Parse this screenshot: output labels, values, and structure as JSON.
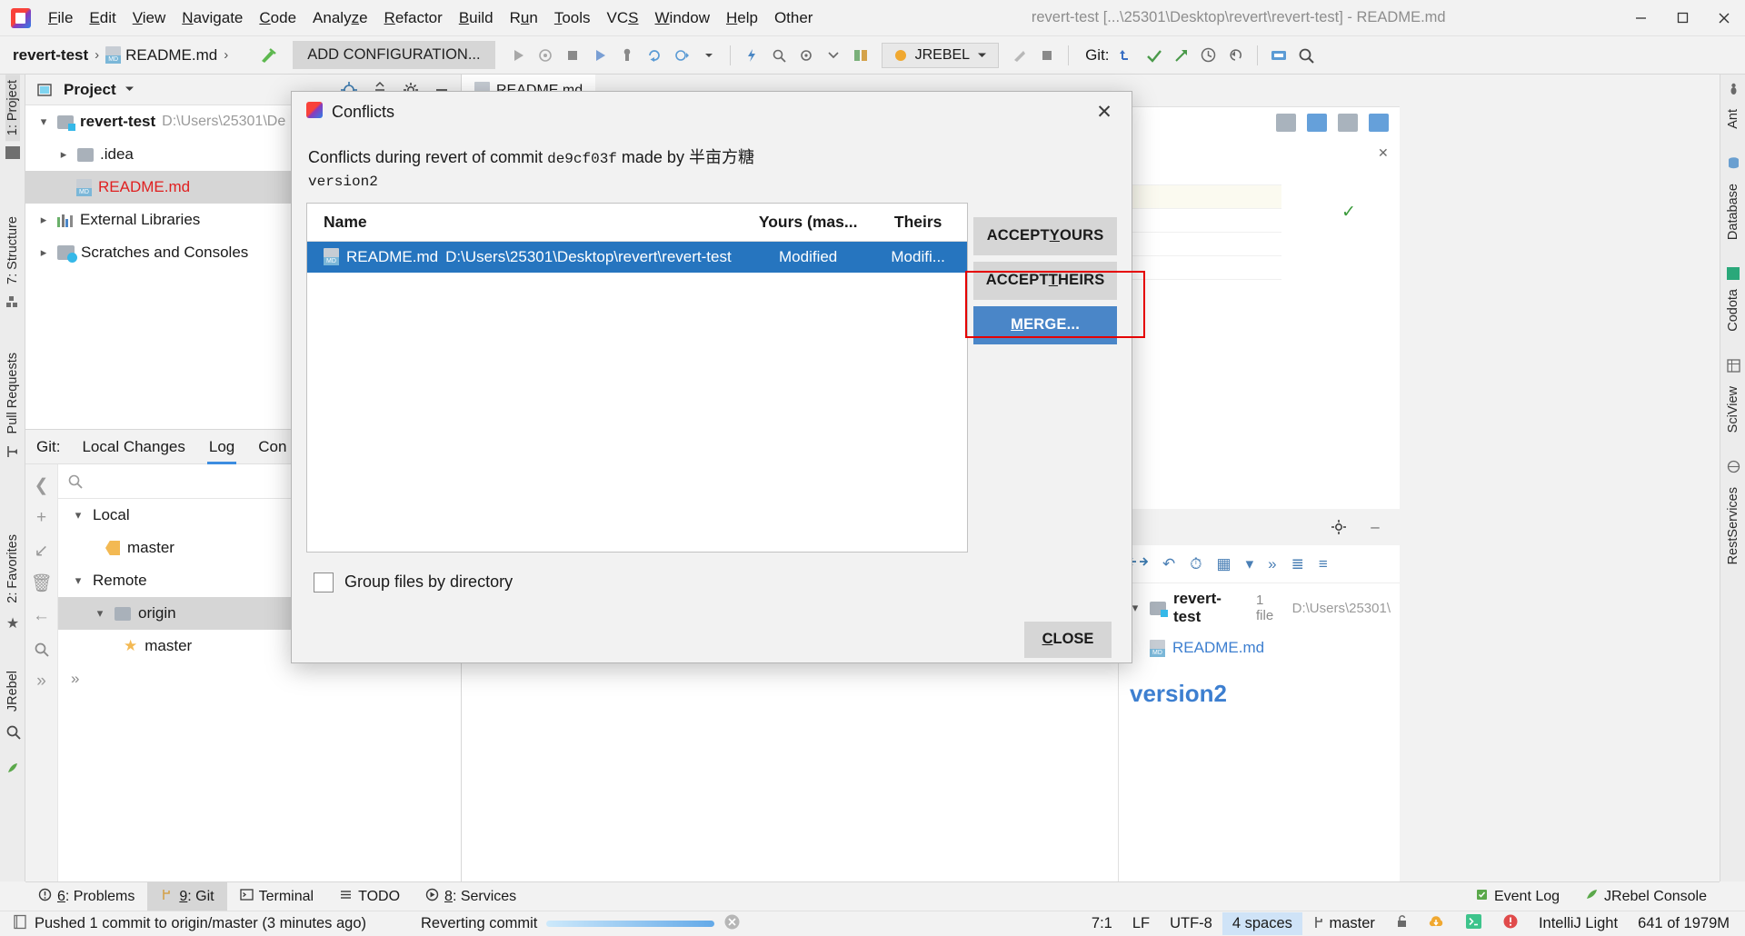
{
  "titlebar": {
    "menus": [
      "File",
      "Edit",
      "View",
      "Navigate",
      "Code",
      "Analyze",
      "Refactor",
      "Build",
      "Run",
      "Tools",
      "VCS",
      "Window",
      "Help",
      "Other"
    ],
    "window_title": "revert-test [...\\25301\\Desktop\\revert\\revert-test] - README.md",
    "minimize": "–",
    "maximize": "❐",
    "close": "✕"
  },
  "navbar": {
    "breadcrumb_project": "revert-test",
    "breadcrumb_file": "README.md",
    "separator": "›",
    "add_configuration": "ADD CONFIGURATION...",
    "jrebel_label": "JREBEL",
    "git_label": "Git:"
  },
  "left_stripe": {
    "project": "1: Project",
    "structure": "7: Structure",
    "pull_requests": "Pull Requests",
    "favorites": "2: Favorites",
    "jrebel": "JRebel"
  },
  "right_stripe": {
    "ant": "Ant",
    "database": "Database",
    "codota": "Codota",
    "sciview": "SciView",
    "restservices": "RestServices"
  },
  "project_panel": {
    "title": "Project",
    "tree": [
      {
        "label": "revert-test",
        "path": "D:\\Users\\25301\\De",
        "icon": "folder-module-icon",
        "expanded": true,
        "indent": 0,
        "bold": true
      },
      {
        "label": ".idea",
        "path": "",
        "icon": "folder-icon",
        "expanded": false,
        "indent": 1,
        "bold": false
      },
      {
        "label": "README.md",
        "path": "",
        "icon": "markdown-icon",
        "expanded": null,
        "indent": 2,
        "bold": false,
        "selected": true,
        "color": "#e02020"
      },
      {
        "label": "External Libraries",
        "path": "",
        "icon": "libraries-icon",
        "expanded": false,
        "indent": 0,
        "bold": false
      },
      {
        "label": "Scratches and Consoles",
        "path": "",
        "icon": "scratches-icon",
        "expanded": false,
        "indent": 0,
        "bold": false
      }
    ]
  },
  "git_panel": {
    "label": "Git:",
    "tabs": [
      {
        "label": "Local Changes",
        "active": false
      },
      {
        "label": "Log",
        "active": true
      },
      {
        "label": "Con",
        "active": false
      }
    ],
    "search_placeholder": "",
    "branches": [
      {
        "label": "Local",
        "type": "group",
        "expanded": true
      },
      {
        "label": "master",
        "type": "tag",
        "selected": false
      },
      {
        "label": "Remote",
        "type": "group",
        "expanded": true
      },
      {
        "label": "origin",
        "type": "folder",
        "selected": true
      },
      {
        "label": "master",
        "type": "star",
        "selected": false
      }
    ]
  },
  "editor": {
    "tab_label": "README.md",
    "version_text": "version2",
    "file_entry": "README.md",
    "repo_entry": "revert-test",
    "repo_files": "1 file",
    "repo_path": "D:\\Users\\25301\\"
  },
  "dialog": {
    "title": "Conflicts",
    "message_prefix": "Conflicts during revert of commit ",
    "commit_hash": "de9cf03f",
    "message_middle": " made by ",
    "author": "半亩方糖",
    "commit_subject": "version2",
    "columns": {
      "name": "Name",
      "yours": "Yours (mas...",
      "theirs": "Theirs"
    },
    "rows": [
      {
        "file": "README.md",
        "path": "D:\\Users\\25301\\Desktop\\revert\\revert-test",
        "yours": "Modified",
        "theirs": "Modifi...",
        "selected": true
      }
    ],
    "buttons": {
      "accept_yours": "ACCEPT YOURS",
      "accept_yours_mnemonic": "Y",
      "accept_theirs": "ACCEPT THEIRS",
      "accept_theirs_mnemonic": "T",
      "merge": "MERGE...",
      "merge_mnemonic": "M",
      "close": "CLOSE",
      "close_mnemonic": "C"
    },
    "group_files_label": "Group files by directory",
    "group_files_checked": false,
    "close_icon": "✕",
    "highlight_color": "#e50000"
  },
  "bottom_tabs": [
    {
      "label": "6: Problems",
      "mnemonic": "6",
      "active": false,
      "icon": "problems-icon"
    },
    {
      "label": "9: Git",
      "mnemonic": "9",
      "active": true,
      "icon": "git-icon"
    },
    {
      "label": "Terminal",
      "mnemonic": "",
      "active": false,
      "icon": "terminal-icon"
    },
    {
      "label": "TODO",
      "mnemonic": "",
      "active": false,
      "icon": "todo-icon"
    },
    {
      "label": "8: Services",
      "mnemonic": "8",
      "active": false,
      "icon": "services-icon"
    }
  ],
  "bottom_right_tabs": [
    {
      "label": "Event Log",
      "icon": "event-log-icon"
    },
    {
      "label": "JRebel Console",
      "icon": "jrebel-icon"
    }
  ],
  "statusbar": {
    "message": "Pushed 1 commit to origin/master (3 minutes ago)",
    "progress_label": "Reverting commit",
    "caret": "7:1",
    "line_separator": "LF",
    "encoding": "UTF-8",
    "indent": "4 spaces",
    "branch": "master",
    "memory": "641 of 1979M",
    "theme_hint": "IntelliJ Light"
  },
  "colors": {
    "accent_blue": "#2675bf",
    "merge_button": "#4a86c8",
    "highlight_red": "#e50000",
    "toolbar_bg": "#f2f2f2",
    "panel_bg": "#ffffff",
    "selection_gray": "#d6d6d6",
    "readme_red": "#e02020",
    "version_blue": "#3d7fd0"
  }
}
